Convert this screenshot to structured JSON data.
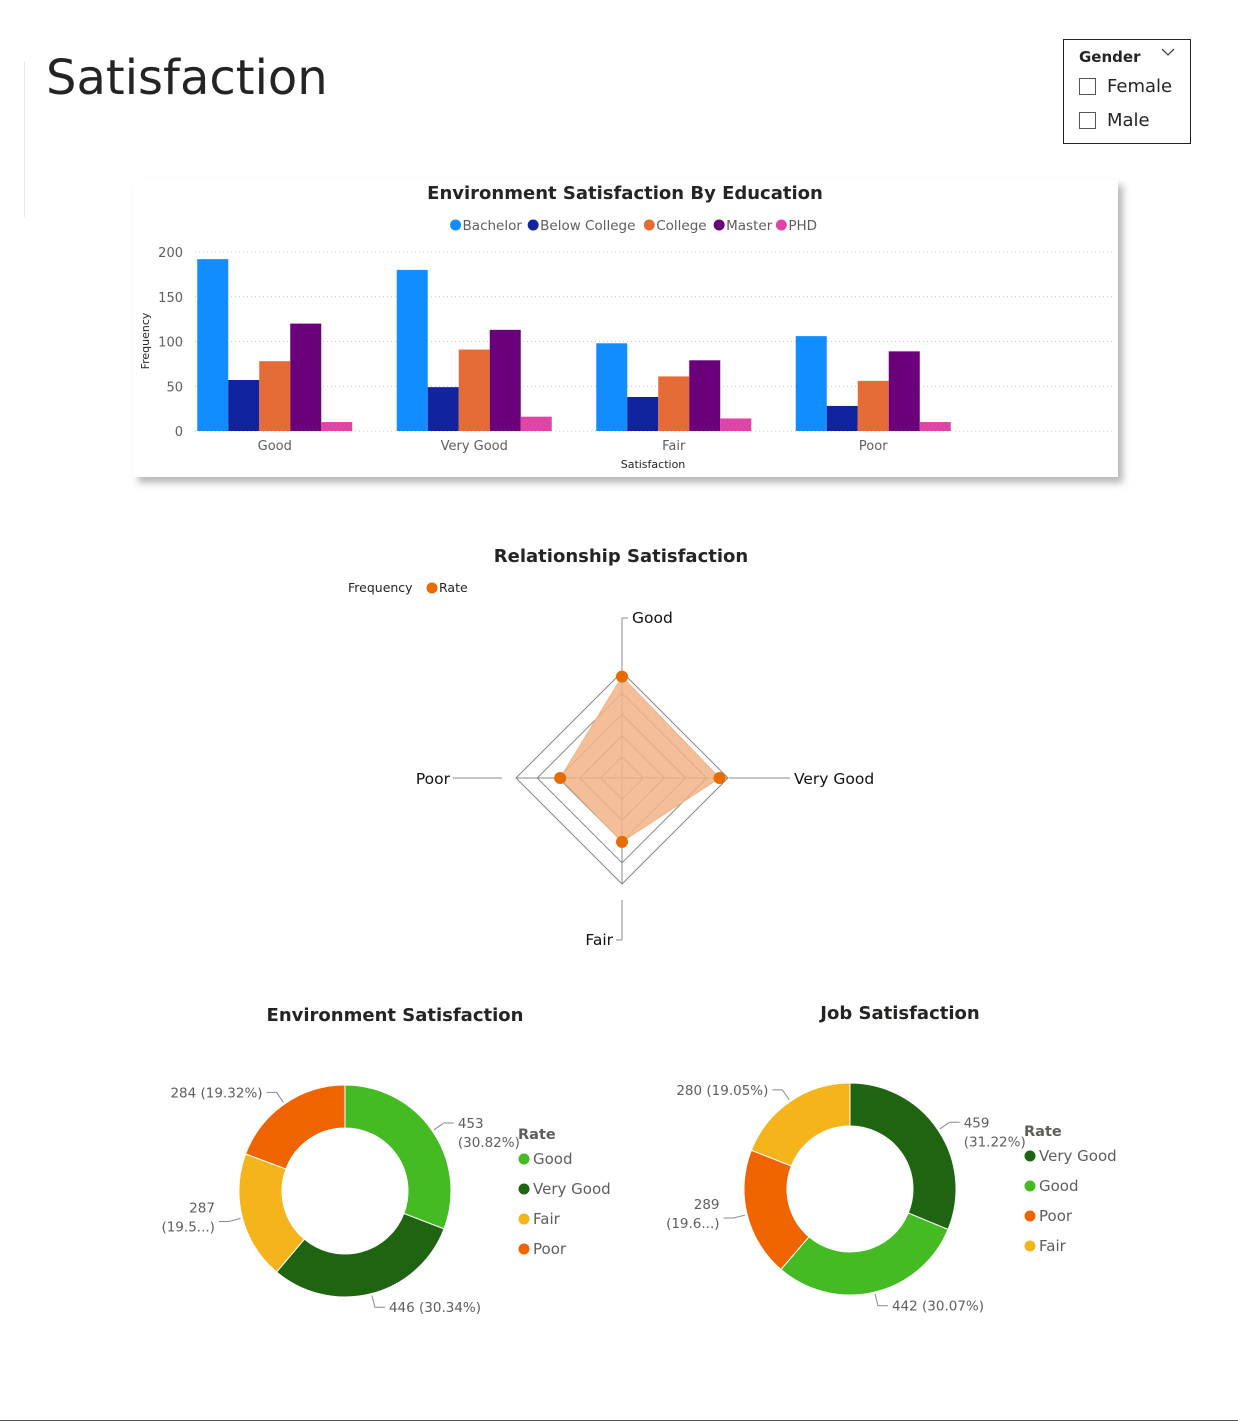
{
  "page": {
    "title": "Satisfaction"
  },
  "slicer": {
    "title": "Gender",
    "chevron_icon": "chevron-down-icon",
    "options": [
      {
        "label": "Female",
        "checked": false
      },
      {
        "label": "Male",
        "checked": false
      }
    ]
  },
  "colors": {
    "Bachelor": "#118dff",
    "Below College": "#12239e",
    "College": "#e66c37",
    "Master": "#6b007b",
    "PHD": "#e044a7",
    "radar": "#e66c00",
    "radar_fill": "#f2b386",
    "Good": "#44bb22",
    "Very Good": "#1e6411",
    "Fair": "#f5b31c",
    "Poor": "#f06400"
  },
  "chart_data": [
    {
      "id": "bar",
      "type": "bar",
      "title": "Environment Satisfaction By Education",
      "xlabel": "Satisfaction",
      "ylabel": "Frequency",
      "categories": [
        "Good",
        "Very Good",
        "Fair",
        "Poor"
      ],
      "series": [
        {
          "name": "Bachelor",
          "values": [
            192,
            180,
            98,
            106
          ]
        },
        {
          "name": "Below College",
          "values": [
            57,
            49,
            38,
            28
          ]
        },
        {
          "name": "College",
          "values": [
            78,
            91,
            61,
            56
          ]
        },
        {
          "name": "Master",
          "values": [
            120,
            113,
            79,
            89
          ]
        },
        {
          "name": "PHD",
          "values": [
            10,
            16,
            14,
            10
          ]
        }
      ],
      "ylim": [
        0,
        200
      ],
      "yticks": [
        0,
        50,
        100,
        150,
        200
      ],
      "grid": true,
      "legend_position": "top"
    },
    {
      "id": "radar",
      "type": "radar",
      "title": "Relationship Satisfaction",
      "legend_title": "Frequency",
      "series": [
        {
          "name": "Rate",
          "values": [
            459,
            442,
            289,
            280
          ]
        }
      ],
      "categories": [
        "Good",
        "Very Good",
        "Fair",
        "Poor"
      ],
      "rmax": 480,
      "rings": 5,
      "legend_position": "top-left"
    },
    {
      "id": "donut_env",
      "type": "pie",
      "title": "Environment Satisfaction",
      "legend_title": "Rate",
      "slices": [
        {
          "label": "Good",
          "value": 453,
          "data_label": [
            "453",
            "(30.82%)"
          ]
        },
        {
          "label": "Very Good",
          "value": 446,
          "data_label": [
            "446 (30.34%)"
          ]
        },
        {
          "label": "Fair",
          "value": 287,
          "data_label": [
            "287",
            "(19.5...)"
          ]
        },
        {
          "label": "Poor",
          "value": 284,
          "data_label": [
            "284 (19.32%)"
          ]
        }
      ],
      "legend_position": "right"
    },
    {
      "id": "donut_job",
      "type": "pie",
      "title": "Job Satisfaction",
      "legend_title": "Rate",
      "slices": [
        {
          "label": "Very Good",
          "value": 459,
          "data_label": [
            "459",
            "(31.22%)"
          ]
        },
        {
          "label": "Good",
          "value": 442,
          "data_label": [
            "442 (30.07%)"
          ]
        },
        {
          "label": "Poor",
          "value": 289,
          "data_label": [
            "289",
            "(19.6...)"
          ]
        },
        {
          "label": "Fair",
          "value": 280,
          "data_label": [
            "280 (19.05%)"
          ]
        }
      ],
      "legend_position": "right"
    }
  ]
}
